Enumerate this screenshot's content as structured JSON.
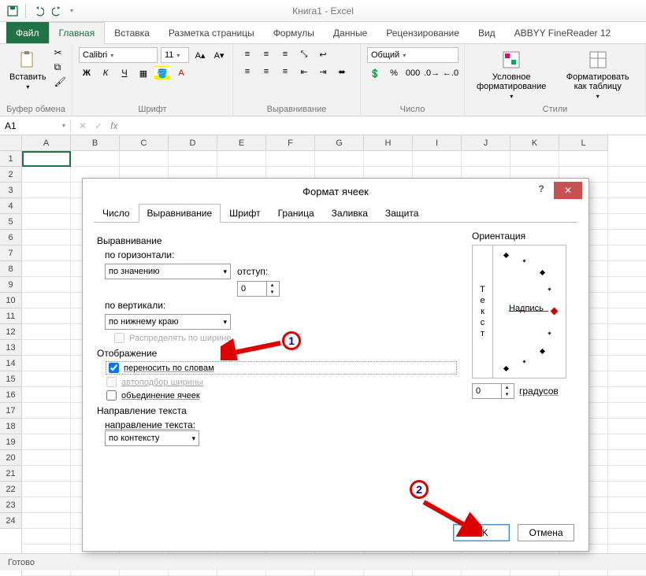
{
  "app": {
    "title": "Книга1 - Excel"
  },
  "qat": {
    "save": "save-icon",
    "undo": "undo-icon",
    "redo": "redo-icon"
  },
  "ribbon_tabs": {
    "file": "Файл",
    "home": "Главная",
    "insert": "Вставка",
    "layout": "Разметка страницы",
    "formulas": "Формулы",
    "data": "Данные",
    "review": "Рецензирование",
    "view": "Вид",
    "abbyy": "ABBYY FineReader 12"
  },
  "ribbon": {
    "clipboard": {
      "label": "Буфер обмена",
      "paste": "Вставить"
    },
    "font": {
      "label": "Шрифт",
      "name": "Calibri",
      "size": "11",
      "bold": "Ж",
      "italic": "К",
      "underline": "Ч"
    },
    "alignment": {
      "label": "Выравнивание"
    },
    "number": {
      "label": "Число",
      "format": "Общий"
    },
    "styles": {
      "label": "Стили",
      "cond": "Условное форматирование",
      "table": "Форматировать как таблицу"
    }
  },
  "namebox": "A1",
  "status": "Готово",
  "dialog": {
    "title": "Формат ячеек",
    "tabs": {
      "number": "Число",
      "alignment": "Выравнивание",
      "font": "Шрифт",
      "border": "Граница",
      "fill": "Заливка",
      "protection": "Защита"
    },
    "align_group": "Выравнивание",
    "h_label": "по горизонтали:",
    "h_value": "по значению",
    "indent_label": "отступ:",
    "indent_value": "0",
    "v_label": "по вертикали:",
    "v_value": "по нижнему краю",
    "distribute": "Распределять по ширине",
    "display_group": "Отображение",
    "wrap": "переносить по словам",
    "autofit": "автоподбор ширины",
    "merge": "объединение ячеек",
    "direction_group": "Направление текста",
    "direction_label": "направление текста:",
    "direction_value": "по контексту",
    "orient_group": "Ориентация",
    "orient_vert": "Текст",
    "orient_label_inline": "Надпись",
    "deg_value": "0",
    "deg_label": "градусов",
    "ok": "OK",
    "cancel": "Отмена"
  },
  "annotations": {
    "one": "1",
    "two": "2"
  }
}
